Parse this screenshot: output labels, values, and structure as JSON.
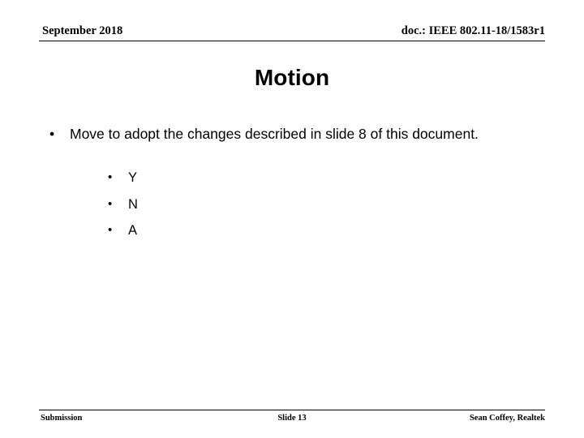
{
  "slide": {
    "background_color": "#ffffff",
    "text_color": "#000000",
    "header": {
      "left": "September 2018",
      "right": "doc.: IEEE 802.11-18/1583r1"
    },
    "title": "Motion",
    "content": {
      "bullets": [
        {
          "marker": "•",
          "text": "Move to adopt the changes described in slide 8 of this document.",
          "children": [
            {
              "marker": "•",
              "text": "Y"
            },
            {
              "marker": "•",
              "text": "N"
            },
            {
              "marker": "•",
              "text": "A"
            }
          ]
        }
      ]
    },
    "footer": {
      "left": "Submission",
      "center": "Slide 13",
      "right": "Sean Coffey, Realtek"
    }
  }
}
